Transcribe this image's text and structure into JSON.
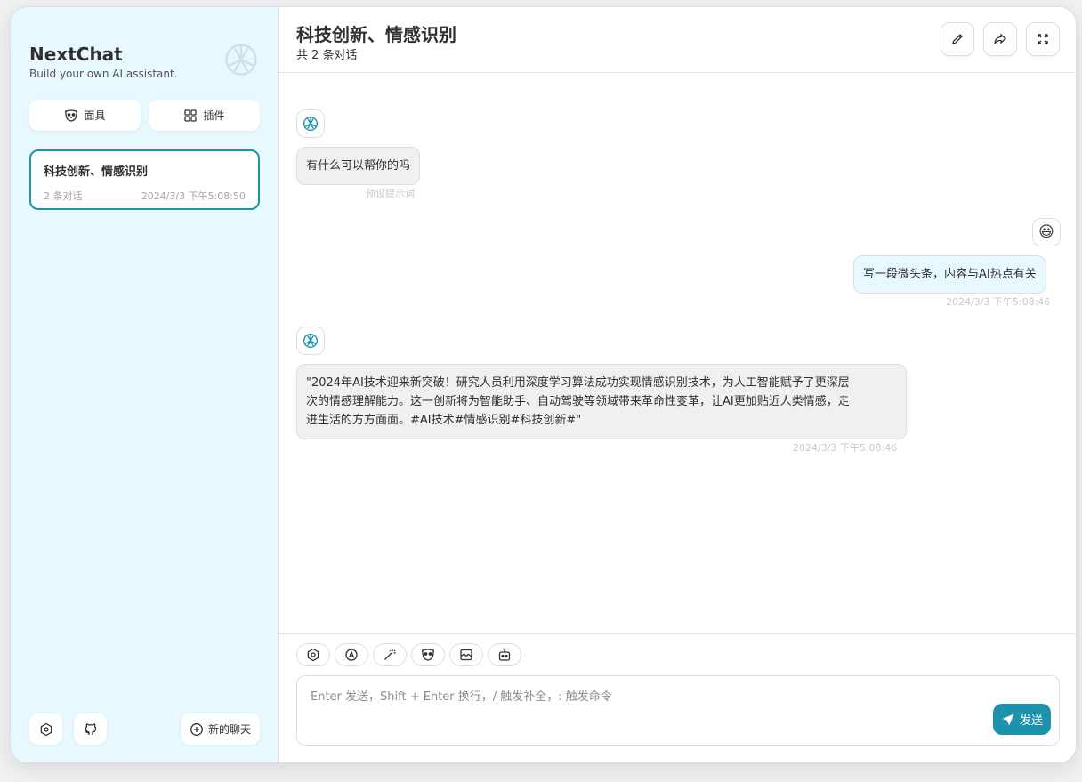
{
  "sidebar": {
    "title": "NextChat",
    "subtitle": "Build your own AI assistant.",
    "mask_button": "面具",
    "plugin_button": "插件",
    "chats": [
      {
        "title": "科技创新、情感识别",
        "count": "2 条对话",
        "time": "2024/3/3 下午5:08:50"
      }
    ],
    "new_chat_button": "新的聊天"
  },
  "header": {
    "title": "科技创新、情感识别",
    "subtitle": "共 2 条对话"
  },
  "messages": [
    {
      "role": "assistant",
      "text": "有什么可以帮你的吗",
      "meta": "预设提示词"
    },
    {
      "role": "user",
      "text": "写一段微头条，内容与AI热点有关",
      "meta": "2024/3/3 下午5:08:46"
    },
    {
      "role": "assistant",
      "text_lines": [
        "\"2024年AI技术迎来新突破！研究人员利用深度学习算法成功实现情感识别技术，为人工智能赋予了更深层",
        "次的情感理解能力。这一创新将为智能助手、自动驾驶等领域带来革命性变革，让AI更加贴近人类情感，走",
        "进生活的方方面面。#AI技术#情感识别#科技创新#\""
      ],
      "meta": "2024/3/3 下午5:08:46"
    }
  ],
  "input": {
    "placeholder": "Enter 发送，Shift + Enter 换行，/ 触发补全，: 触发命令",
    "send_label": "发送"
  },
  "colors": {
    "accent": "#1d93ab",
    "sidebar_bg": "#e7f8ff",
    "bubble_bot": "#f0f0f0"
  }
}
